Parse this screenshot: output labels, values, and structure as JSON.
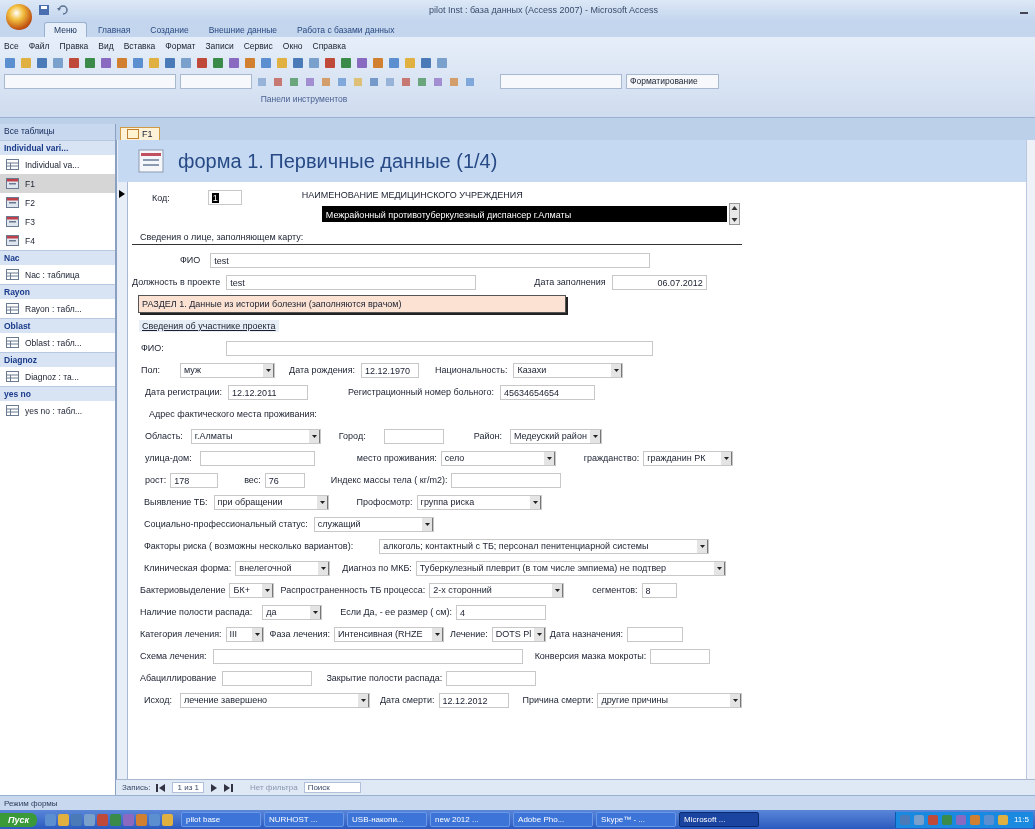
{
  "window": {
    "title": "pilot Inst : база данных (Access 2007) - Microsoft Access"
  },
  "ribbon_tabs": [
    {
      "label": "Меню",
      "selected": true
    },
    {
      "label": "Главная",
      "selected": false
    },
    {
      "label": "Создание",
      "selected": false
    },
    {
      "label": "Внешние данные",
      "selected": false
    },
    {
      "label": "Работа с базами данных",
      "selected": false
    }
  ],
  "menu_bar": [
    "Все",
    "Файл",
    "Правка",
    "Вид",
    "Вставка",
    "Формат",
    "Записи",
    "Сервис",
    "Окно",
    "Справка"
  ],
  "toolbar": {
    "format_dropdown": "Форматирование",
    "group_label": "Панели инструментов"
  },
  "nav_pane": {
    "title": "Все таблицы",
    "groups": [
      {
        "label": "Individual vari...",
        "items": [
          {
            "label": "Individual va...",
            "kind": "table",
            "selected": false
          },
          {
            "label": "F1",
            "kind": "form",
            "selected": true
          },
          {
            "label": "F2",
            "kind": "form",
            "selected": false
          },
          {
            "label": "F3",
            "kind": "form",
            "selected": false
          },
          {
            "label": "F4",
            "kind": "form",
            "selected": false
          }
        ]
      },
      {
        "label": "Nac",
        "items": [
          {
            "label": "Nac : таблица",
            "kind": "table",
            "selected": false
          }
        ]
      },
      {
        "label": "Rayon",
        "items": [
          {
            "label": "Rayon : табл...",
            "kind": "table",
            "selected": false
          }
        ]
      },
      {
        "label": "Oblast",
        "items": [
          {
            "label": "Oblast : табл...",
            "kind": "table",
            "selected": false
          }
        ]
      },
      {
        "label": "Diagnoz",
        "items": [
          {
            "label": "Diagnoz : та...",
            "kind": "table",
            "selected": false
          }
        ]
      },
      {
        "label": "yes no",
        "items": [
          {
            "label": "yes no : табл...",
            "kind": "table",
            "selected": false
          }
        ]
      }
    ]
  },
  "document_tab": {
    "label": "F1"
  },
  "form": {
    "title": "форма 1.  Первичные данные  (1/4)",
    "code": {
      "label": "Код:",
      "value": "1"
    },
    "institution": {
      "label": "НАИМЕНОВАНИЕ МЕДИЦИНСКОГО УЧРЕЖДЕНИЯ",
      "value": "Межрайонный противотуберкулезный диспансер г.Алматы"
    },
    "rows": [
      {
        "fields": [
          {
            "kind": "heading",
            "text": "Сведения о лице, заполняющем карту:"
          }
        ]
      },
      {
        "fields": [
          {
            "kind": "label",
            "text": "ФИО"
          },
          {
            "kind": "text",
            "value": "test"
          }
        ]
      },
      {
        "fields": [
          {
            "kind": "label",
            "text": "Должность в проекте"
          },
          {
            "kind": "text",
            "value": "test"
          },
          {
            "kind": "label",
            "text": "Дата заполнения"
          },
          {
            "kind": "date",
            "value": "06.07.2012"
          }
        ]
      },
      {
        "fields": [
          {
            "kind": "banner",
            "text": "РАЗДЕЛ 1. Данные из истории болезни (заполняются врачом)"
          }
        ]
      },
      {
        "fields": [
          {
            "kind": "subheading",
            "text": "Сведения об участнике проекта"
          }
        ]
      },
      {
        "fields": [
          {
            "kind": "label",
            "text": "ФИО:"
          },
          {
            "kind": "text"
          }
        ]
      },
      {
        "fields": [
          {
            "kind": "label",
            "text": "Пол:"
          },
          {
            "kind": "combo",
            "value": "муж"
          },
          {
            "kind": "label",
            "text": "Дата рождения:"
          },
          {
            "kind": "text",
            "value": "12.12.1970"
          },
          {
            "kind": "label",
            "text": "Национальность:"
          },
          {
            "kind": "combo",
            "value": "Казахи"
          }
        ]
      },
      {
        "fields": [
          {
            "kind": "label",
            "text": "Дата регистрации:"
          },
          {
            "kind": "text",
            "value": "12.12.2011"
          },
          {
            "kind": "label",
            "text": "Регистрационный номер больного:"
          },
          {
            "kind": "text",
            "value": "45634654654"
          }
        ]
      },
      {
        "fields": [
          {
            "kind": "label",
            "text": "Адрес фактического места проживания:"
          }
        ]
      },
      {
        "fields": [
          {
            "kind": "label",
            "text": "Область:"
          },
          {
            "kind": "combo",
            "value": "г.Алматы"
          },
          {
            "kind": "label",
            "text": "Город:"
          },
          {
            "kind": "text"
          },
          {
            "kind": "label",
            "text": "Район:"
          },
          {
            "kind": "combo",
            "value": "Медеуский район"
          }
        ]
      },
      {
        "fields": [
          {
            "kind": "label",
            "text": "улица-дом:"
          },
          {
            "kind": "text"
          },
          {
            "kind": "label",
            "text": "место проживания:"
          },
          {
            "kind": "combo",
            "value": "село"
          },
          {
            "kind": "label",
            "text": "гражданство:"
          },
          {
            "kind": "combo",
            "value": "гражданин РК"
          }
        ]
      },
      {
        "fields": [
          {
            "kind": "label",
            "text": "рост:"
          },
          {
            "kind": "text",
            "value": "178"
          },
          {
            "kind": "label",
            "text": "вес:"
          },
          {
            "kind": "text",
            "value": "76"
          },
          {
            "kind": "label",
            "text": "Индекс массы тела ( кг/m2):"
          },
          {
            "kind": "text"
          }
        ]
      },
      {
        "fields": [
          {
            "kind": "label",
            "text": "Выявление ТБ:"
          },
          {
            "kind": "combo",
            "value": "при обращении"
          },
          {
            "kind": "label",
            "text": "Профосмотр:"
          },
          {
            "kind": "combo",
            "value": "группа риска"
          }
        ]
      },
      {
        "fields": [
          {
            "kind": "label",
            "text": "Социально-профессиональный статус:"
          },
          {
            "kind": "combo",
            "value": "служащий"
          }
        ]
      },
      {
        "fields": [
          {
            "kind": "label",
            "text": "Факторы риска ( возможны несколько вариантов):"
          },
          {
            "kind": "combo",
            "value": "алкоголь; контактный с ТБ; персонал пенитенциарной системы"
          }
        ]
      },
      {
        "fields": [
          {
            "kind": "label",
            "text": "Клиническая форма:"
          },
          {
            "kind": "combo",
            "value": "внелегочной"
          },
          {
            "kind": "label",
            "text": "Диагноз по МКБ:"
          },
          {
            "kind": "combo",
            "value": "Туберкулезный плеврит (в том числе эмпиема) не подтвер"
          }
        ]
      },
      {
        "fields": [
          {
            "kind": "label",
            "text": "Бактериовыделение"
          },
          {
            "kind": "combo",
            "value": "БК+"
          },
          {
            "kind": "label",
            "text": "Распространенность ТБ процесса:"
          },
          {
            "kind": "combo",
            "value": "2-х сторонний"
          },
          {
            "kind": "label",
            "text": "сегментов:"
          },
          {
            "kind": "text",
            "value": "8"
          }
        ]
      },
      {
        "fields": [
          {
            "kind": "label",
            "text": "Наличие полости распада:"
          },
          {
            "kind": "combo",
            "value": "да"
          },
          {
            "kind": "label",
            "text": "Если Да, - ее размер ( см):"
          },
          {
            "kind": "text",
            "value": "4"
          }
        ]
      },
      {
        "fields": [
          {
            "kind": "label",
            "text": "Категория лечения:"
          },
          {
            "kind": "combo",
            "value": "III"
          },
          {
            "kind": "label",
            "text": "Фаза лечения:"
          },
          {
            "kind": "combo",
            "value": "Интенсивная (RHZE"
          },
          {
            "kind": "label",
            "text": "Лечение:"
          },
          {
            "kind": "combo",
            "value": "DOTS Pl"
          },
          {
            "kind": "label",
            "text": "Дата назначения:"
          },
          {
            "kind": "text"
          }
        ]
      },
      {
        "fields": [
          {
            "kind": "label",
            "text": "Схема лечения:"
          },
          {
            "kind": "text"
          },
          {
            "kind": "label",
            "text": "Конверсия мазка мокроты:"
          },
          {
            "kind": "text"
          }
        ]
      },
      {
        "fields": [
          {
            "kind": "label",
            "text": "Абациллирование"
          },
          {
            "kind": "text"
          },
          {
            "kind": "label",
            "text": "Закрытие полости распада:"
          },
          {
            "kind": "text"
          }
        ]
      },
      {
        "fields": [
          {
            "kind": "label",
            "text": "Исход:"
          },
          {
            "kind": "combo",
            "value": "лечение завершено"
          },
          {
            "kind": "label",
            "text": "Дата смерти:"
          },
          {
            "kind": "text",
            "value": "12.12.2012"
          },
          {
            "kind": "label",
            "text": "Причина смерти:"
          },
          {
            "kind": "combo",
            "value": "другие причины"
          }
        ]
      }
    ]
  },
  "record_nav": {
    "label": "Запись:",
    "position": "1 из 1",
    "filter": "Нет фильтра",
    "search": "Поиск"
  },
  "status_bar": "Режим формы",
  "taskbar": {
    "start": "Пуск",
    "items": [
      {
        "label": "pilot base",
        "selected": false
      },
      {
        "label": "NURHOST ...",
        "selected": false
      },
      {
        "label": "USB-накопи...",
        "selected": false
      },
      {
        "label": "new 2012 ...",
        "selected": false
      },
      {
        "label": "Adobe Pho...",
        "selected": false
      },
      {
        "label": "Skype™ - ...",
        "selected": false
      },
      {
        "label": "Microsoft ...",
        "selected": true
      }
    ],
    "clock": "11:5"
  }
}
